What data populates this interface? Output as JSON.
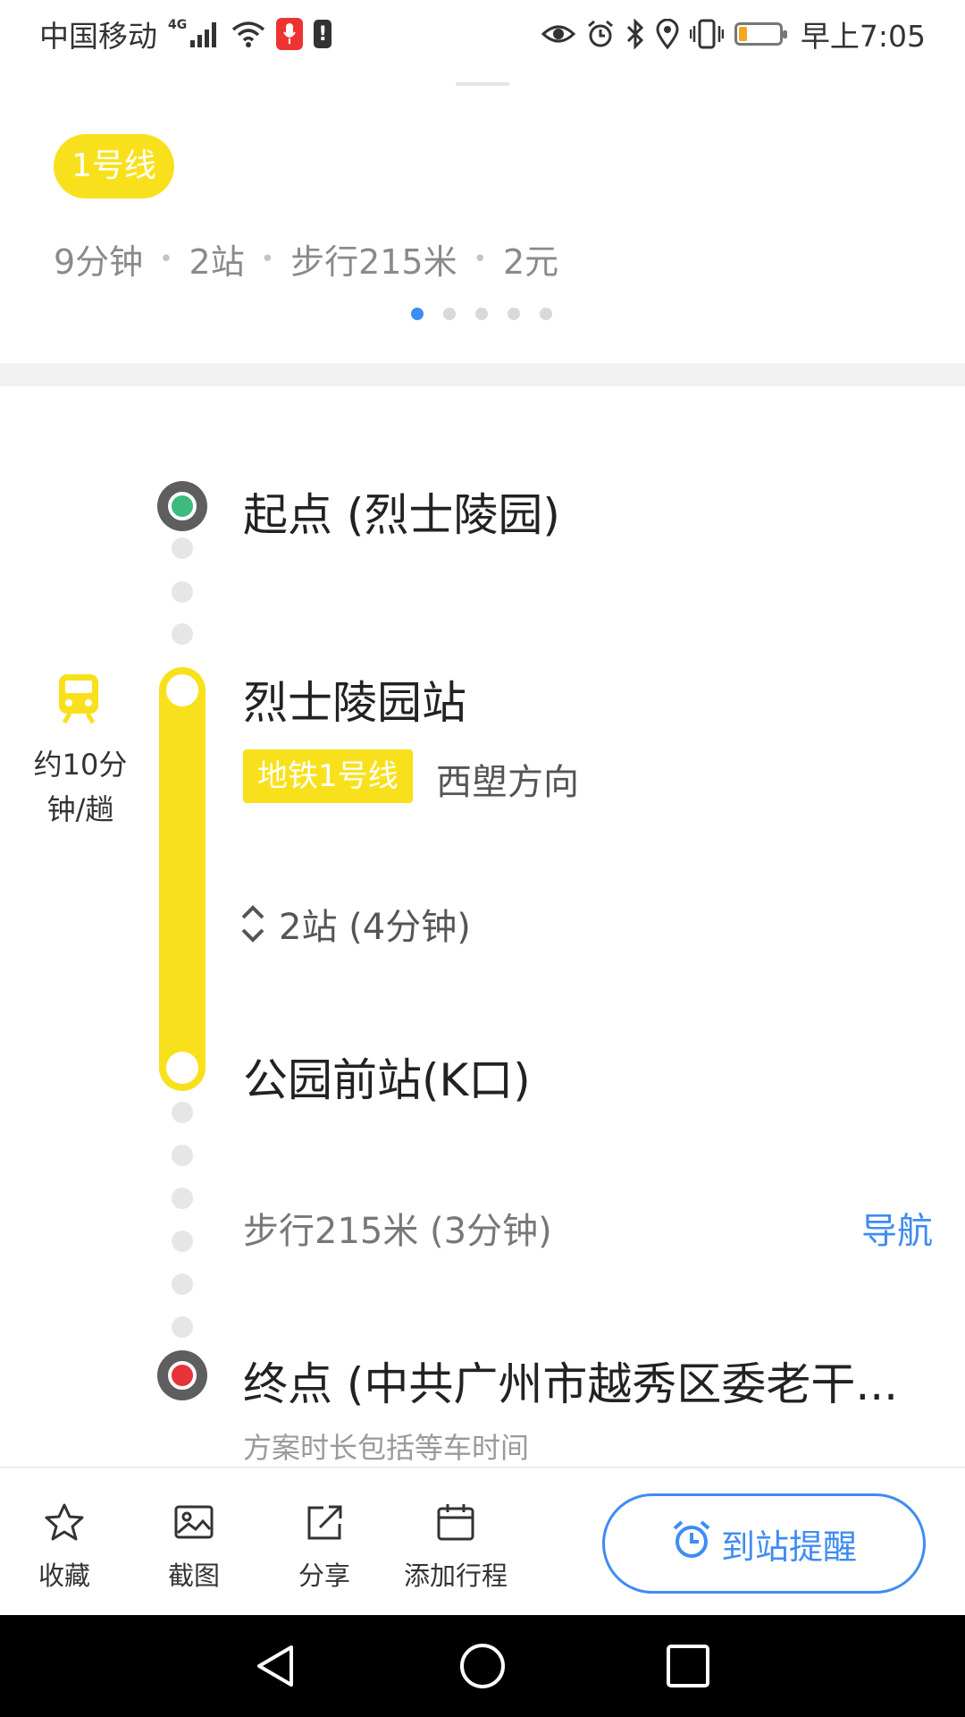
{
  "status_bar": {
    "carrier": "中国移动",
    "network": "4G",
    "time": "早上7:05",
    "battery_level": 0.2,
    "accent_colors": {
      "mic": "#e33333",
      "battery": "#f5a623"
    }
  },
  "route_card": {
    "line_badge": "1号线",
    "summary": {
      "duration": "9分钟",
      "stops": "2站",
      "walk": "步行215米",
      "fare": "2元"
    },
    "page_count": 5,
    "page_active": 1
  },
  "route": {
    "start_label": "起点 (烈士陵园)",
    "board_station": "烈士陵园站",
    "line_tag": "地铁1号线",
    "direction": "西塱方向",
    "frequency": "约10分钟/趟",
    "frequency_line1": "约10分",
    "frequency_line2": "钟/趟",
    "stops_info": "2站 (4分钟)",
    "alight_station": "公园前站(K口)",
    "walk_info": "步行215米 (3分钟)",
    "nav_label": "导航",
    "end_label": "终点 (中共广州市越秀区委老干...",
    "note": "方案时长包括等车时间",
    "colors": {
      "subway_line": "#f8e11c",
      "start_node": "#3dbb7c",
      "end_node": "#e8333a",
      "link": "#3f8cf2"
    }
  },
  "actions": {
    "favorite": "收藏",
    "screenshot": "截图",
    "share": "分享",
    "add_trip": "添加行程",
    "arrival_reminder": "到站提醒"
  },
  "icons": [
    "star-icon",
    "image-icon",
    "share-icon",
    "calendar-icon",
    "alarm-icon",
    "train-icon",
    "back-icon",
    "home-icon",
    "recents-icon"
  ]
}
